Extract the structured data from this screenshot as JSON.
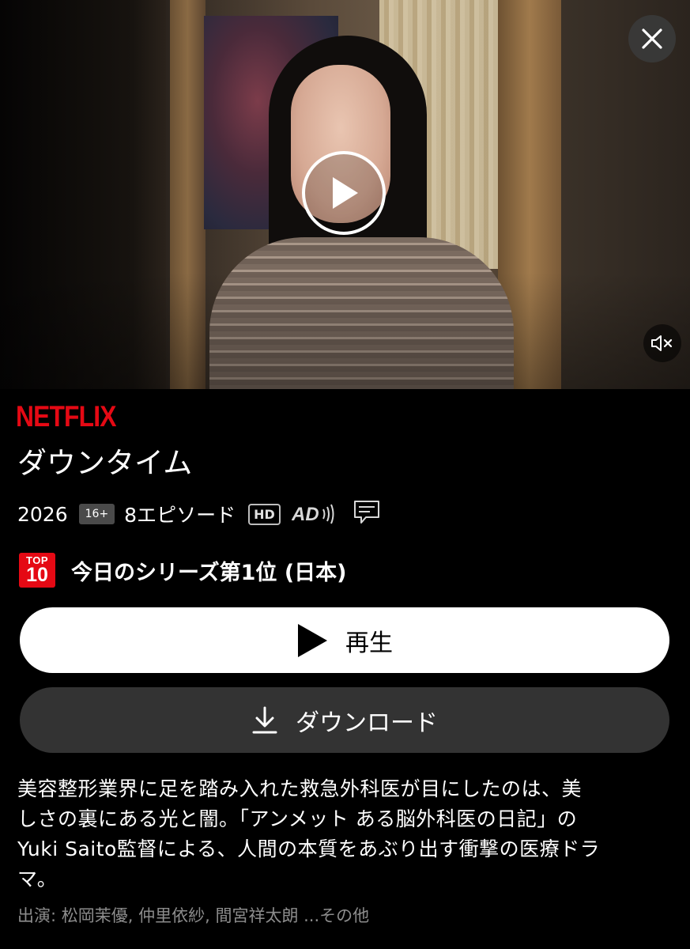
{
  "hero": {
    "close_icon": "close-icon",
    "play_icon": "play-circle-icon",
    "mute_icon": "speaker-muted-icon"
  },
  "brand": "NETFLIX",
  "title": "ダウンタイム",
  "meta": {
    "year": "2026",
    "rating": "16+",
    "episodes": "8エピソード",
    "hd": "HD",
    "ad_label": "AD",
    "subtitles_icon": "subtitles-icon"
  },
  "top10": {
    "badge_top": "TOP",
    "badge_bottom": "10",
    "text": "今日のシリーズ第1位 (日本)"
  },
  "buttons": {
    "play": "再生",
    "download": "ダウンロード"
  },
  "description_lines": [
    "美容整形業界に足を踏み入れた救急外科医が目にしたのは、美",
    "しさの裏にある光と闇。「アンメット ある脳外科医の日記」の",
    "Yuki Saito監督による、人間の本質をあぶり出す衝撃の医療ドラ",
    "マ。"
  ],
  "cast": "出演: 松岡茉優, 仲里依紗, 間宮祥太朗 ...その他",
  "colors": {
    "brand_red": "#e50914",
    "download_bg": "#333333",
    "muted_text": "#8c8c8c"
  }
}
